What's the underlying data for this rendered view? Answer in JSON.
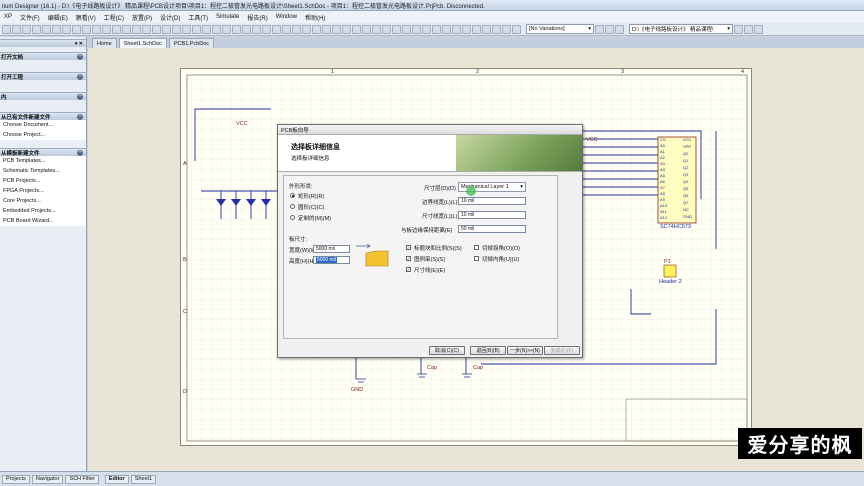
{
  "window": {
    "title": "tium Designer (16.1) - D:\\《电子线路板设计》 精品课程\\PCB设计项目\\项目1：程控二极管发光电路板设计\\Sheet1.SchDoc - 项目1：程控二极管发光电路板设计.PrjPcb. Disconnected."
  },
  "menu": [
    "XP",
    "文件(F)",
    "编辑(E)",
    "察看(V)",
    "工程(C)",
    "放置(P)",
    "设计(D)",
    "工具(T)",
    "Simulate",
    "报告(R)",
    "Window",
    "帮助(H)"
  ],
  "toolbar": {
    "variations": "[No Variations]",
    "path": "D:\\《电子线路板设计》 精品课程\\"
  },
  "doc_tabs": [
    "Home",
    "Sheet1.SchDoc",
    "PCB1.PcbDoc"
  ],
  "left_panel": {
    "sections": [
      {
        "title": "打开文档",
        "items": []
      },
      {
        "title": "打开工程",
        "items": []
      },
      {
        "title": "内",
        "items": []
      },
      {
        "title": "从已有文件新建文件",
        "items": [
          "Choose Document...",
          "Choose Project..."
        ]
      },
      {
        "title": "从模板新建文件",
        "items": [
          "PCB Templates...",
          "Schematic Templates...",
          "PCB Projects...",
          "FPGA Projects...",
          "Core Projects...",
          "Embedded Projects...",
          "PCB Board Wizard..."
        ]
      }
    ]
  },
  "schematic": {
    "labels": {
      "vcc": "VCC",
      "gnd": "GND",
      "header": "Header 2",
      "p1": "P1",
      "chip": "SC74HC573",
      "vcc2": "VCC",
      "c1": "Cap",
      "c2": "Cap"
    },
    "chip_pins_left": [
      "CS",
      "A0",
      "A1",
      "A2",
      "A3",
      "A4",
      "A5",
      "A6",
      "A7",
      "A8",
      "A9",
      "A10",
      "A11",
      "A12"
    ],
    "chip_pins_right": [
      "VCC",
      "VPP",
      "Q0",
      "Q1",
      "Q2",
      "Q3",
      "Q4",
      "Q5",
      "Q6",
      "Q7",
      "NC",
      "GND"
    ],
    "rows": [
      "A",
      "B",
      "C",
      "D"
    ],
    "cols": [
      "1",
      "2",
      "3",
      "4"
    ]
  },
  "wizard": {
    "title": "PCB板向导",
    "header_title": "选择板详细信息",
    "header_subtitle": "选择板详细信息",
    "shape_label": "外形形状:",
    "shapes": [
      {
        "label": "矩形(R)(R)",
        "selected": true
      },
      {
        "label": "圆形(C)(C)",
        "selected": false
      },
      {
        "label": "定制的(M)(M)",
        "selected": false
      }
    ],
    "size_label": "板尺寸:",
    "width_label": "宽度(W)(W)",
    "width_value": "5000 mil",
    "height_label": "高度(H)(H)",
    "height_value": "5000 mil",
    "dim_layer_label": "尺寸层(D)(D)",
    "dim_layer_value": "Mechanical Layer 1",
    "border_width_label": "边界线宽(L)(L)",
    "border_width_value": "10 mil",
    "dim_line_width_label": "尺寸线宽(L)(L)",
    "dim_line_width_value": "10 mil",
    "keepout_label": "与板边缘保持距离(E)",
    "keepout_value": "50 mil",
    "checks": [
      {
        "label": "标题块和比例(S)(S)",
        "checked": true
      },
      {
        "label": "切掉拐角(O)(O)",
        "checked": false
      },
      {
        "label": "图例串(S)(S)",
        "checked": true
      },
      {
        "label": "切掉内角(U)(U)",
        "checked": false
      },
      {
        "label": "尺寸线(E)(E)",
        "checked": true
      }
    ],
    "buttons": {
      "cancel": "取消(C)(C)",
      "back": "退回(B)(B)",
      "next": "一步(N)>>(N)",
      "finish": "完成(F)(F)"
    }
  },
  "status_tabs": [
    "Projects",
    "Navigator",
    "SCH Filter"
  ],
  "editor_tabs": [
    "Editor",
    "Sheet1"
  ],
  "watermark": "爱分享的枫"
}
